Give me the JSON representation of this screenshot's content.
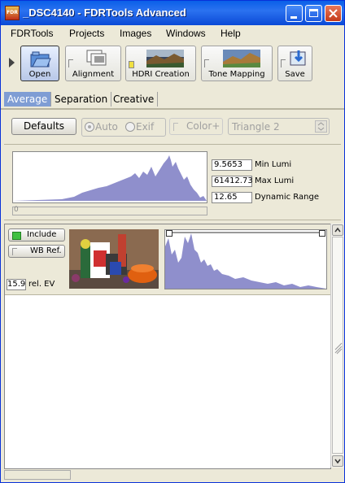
{
  "window": {
    "title": "_DSC4140 - FDRTools Advanced",
    "icon_text": "FDR"
  },
  "menu": [
    "FDRTools",
    "Projects",
    "Images",
    "Windows",
    "Help"
  ],
  "toolbar": {
    "open": "Open",
    "alignment": "Alignment",
    "hdri": "HDRI Creation",
    "tone": "Tone Mapping",
    "save": "Save"
  },
  "tabs": [
    "Average",
    "Separation",
    "Creative"
  ],
  "controls": {
    "defaults": "Defaults",
    "auto": "Auto",
    "exif": "Exif",
    "color": "Color+",
    "select": "Triangle 2"
  },
  "stats": [
    {
      "value": "9.5653",
      "label": "Min Lumi"
    },
    {
      "value": "61412.73",
      "label": "Max Lumi"
    },
    {
      "value": "12.65",
      "label": "Dynamic Range"
    }
  ],
  "slider_value": "0",
  "image_item": {
    "include": "Include",
    "wbref": "WB Ref.",
    "ev_value": "15.9",
    "ev_label": "rel. EV"
  },
  "colors": {
    "histogram": "#8f8fcc",
    "accent": "#7f9dd4"
  }
}
